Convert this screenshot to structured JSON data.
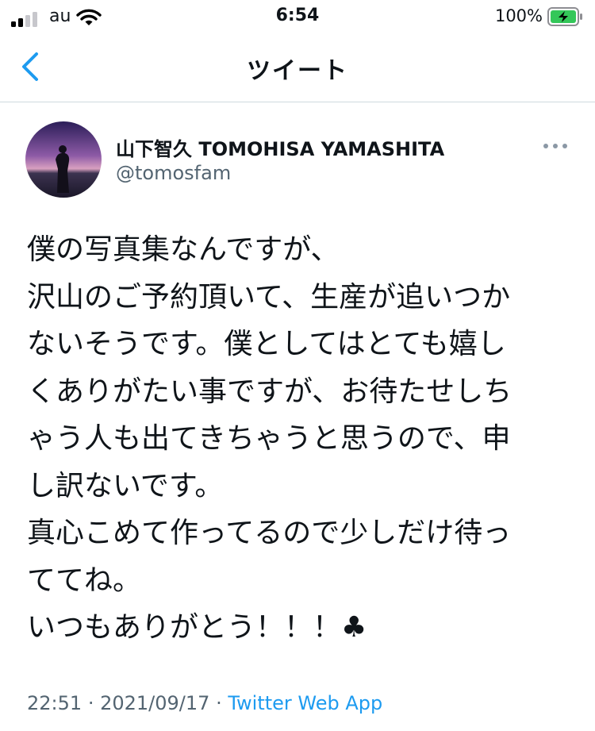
{
  "status_bar": {
    "carrier": "au",
    "time": "6:54",
    "battery": "100%",
    "battery_color": "#34c759"
  },
  "nav": {
    "title": "ツイート",
    "accent_color": "#1d9bf0"
  },
  "tweet": {
    "display_name": "山下智久 TOMOHISA YAMASHITA",
    "handle": "@tomosfam",
    "text": "僕の写真集なんですが、\n沢山のご予約頂いて、生産が追いつか\nないそうです。僕としてはとても嬉し\nくありがたい事ですが、お待たせしち\nゃう人も出てきちゃうと思うので、申\nし訳ないです。\n真心こめて作ってるので少しだけ待っ\nててね。\nいつもありがとう！！！♣",
    "time": "22:51",
    "date": "2021/09/17",
    "separator": "·",
    "source": "Twitter Web App"
  },
  "icons": [
    "signal-icon",
    "wifi-icon",
    "battery-charging-icon",
    "back-chevron-icon",
    "more-icon"
  ]
}
